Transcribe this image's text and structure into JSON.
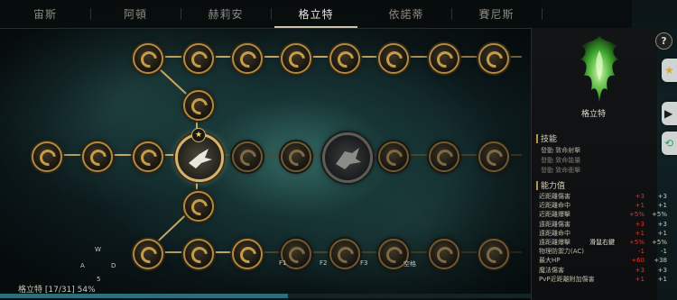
{
  "tabs": [
    "宙斯",
    "阿頓",
    "赫莉安",
    "格立特",
    "依諾蒂",
    "賽尼斯"
  ],
  "active_tab": "格立特",
  "hotkeys": {
    "w": "W",
    "a": "A",
    "d": "D",
    "f1": "F1",
    "f2": "F2",
    "f3": "F3",
    "space": "空格"
  },
  "tree_progress": {
    "label": "格立特 [17/31] 54%",
    "superscript": "5",
    "fraction": 0.54
  },
  "emblem_name": "格立特",
  "skills": {
    "title": "技能",
    "items": [
      "發動 致命射擊",
      "發動 致命能量",
      "發動 致命衝擊"
    ]
  },
  "stats": {
    "title": "能力值",
    "rows": [
      {
        "name": "近距離傷害",
        "delta": "+3",
        "value": "+3"
      },
      {
        "name": "近距離命中",
        "delta": "+1",
        "value": "+1"
      },
      {
        "name": "近距離爆擊",
        "delta": "+5%",
        "value": "+5%"
      },
      {
        "name": "遠距離傷害",
        "delta": "+3",
        "value": "+3"
      },
      {
        "name": "遠距離命中",
        "delta": "+1",
        "value": "+1"
      },
      {
        "name": "遠距離爆擊",
        "delta": "+5%",
        "value": "+5%"
      },
      {
        "name": "物理防禦力(AC)",
        "delta": "-1",
        "value": "-1"
      },
      {
        "name": "最大HP",
        "delta": "+60",
        "value": "+38"
      },
      {
        "name": "魔法傷害",
        "delta": "+3",
        "value": "+3"
      },
      {
        "name": "PvP近距離附加傷害",
        "delta": "+1",
        "value": "+1"
      }
    ]
  },
  "tooltip": "滑鼠右鍵",
  "help_label": "?",
  "colors": {
    "accent_gold": "#c59c48",
    "bonus_red": "#d13b30",
    "progress": "#2c6f7b",
    "emblem_green": "#5fd14a"
  }
}
